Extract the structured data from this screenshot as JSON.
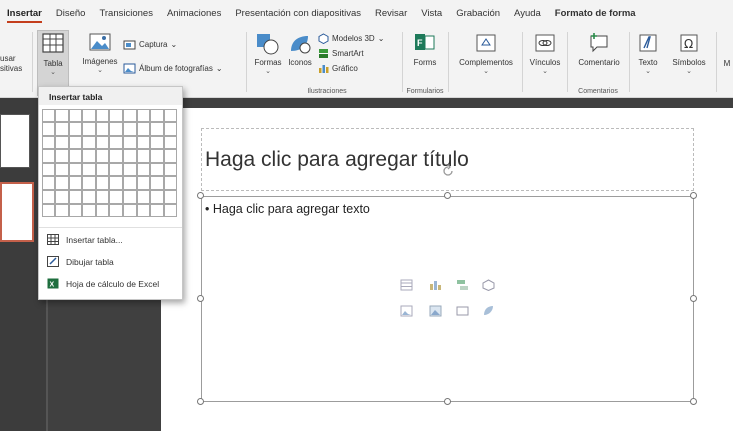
{
  "tabs": [
    {
      "label": "Insertar",
      "active": true
    },
    {
      "label": "Diseño"
    },
    {
      "label": "Transiciones"
    },
    {
      "label": "Animaciones"
    },
    {
      "label": "Presentación con diapositivas"
    },
    {
      "label": "Revisar"
    },
    {
      "label": "Vista"
    },
    {
      "label": "Grabación"
    },
    {
      "label": "Ayuda"
    },
    {
      "label": "Formato de forma",
      "bold": true
    }
  ],
  "ribbon": {
    "reuse_line1": "usar",
    "reuse_line2": "sitivas",
    "tabla": "Tabla",
    "imagenes": "Imágenes",
    "captura": "Captura",
    "album": "Álbum de fotografías",
    "formas": "Formas",
    "iconos": "Iconos",
    "modelos3d": "Modelos 3D",
    "smartart": "SmartArt",
    "grafico": "Gráfico",
    "ilustraciones_group": "Ilustraciones",
    "forms": "Forms",
    "formularios_group": "Formularios",
    "complementos": "Complementos",
    "vinculos": "Vínculos",
    "comentario": "Comentario",
    "comentarios_group": "Comentarios",
    "texto": "Texto",
    "simbolos": "Símbolos",
    "overflow": "M"
  },
  "dropdown": {
    "header": "Insertar tabla",
    "grid_cols": 10,
    "grid_rows": 8,
    "items": [
      {
        "label": "Insertar tabla...",
        "icon": "table-icon"
      },
      {
        "label": "Dibujar tabla",
        "icon": "draw-table-icon"
      },
      {
        "label": "Hoja de cálculo de Excel",
        "icon": "excel-icon"
      }
    ]
  },
  "slide": {
    "title_placeholder": "Haga clic para agregar título",
    "body_placeholder": "• Haga clic para agregar texto"
  },
  "colors": {
    "accent": "#c43e1c",
    "ribbon_bg": "#f3f3f3",
    "workspace_bg": "#404040"
  }
}
